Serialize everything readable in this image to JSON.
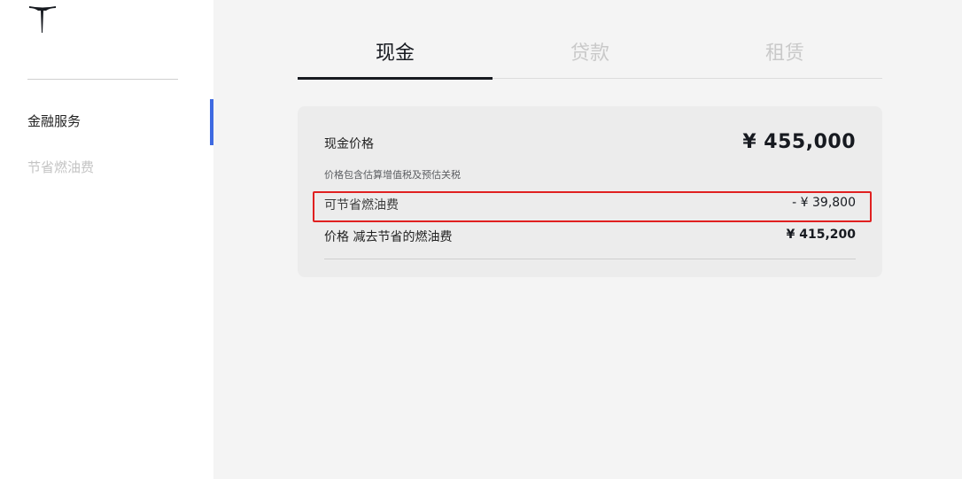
{
  "sidebar": {
    "items": [
      {
        "label": "金融服务",
        "active": true
      },
      {
        "label": "节省燃油费",
        "active": false
      }
    ]
  },
  "tabs": [
    {
      "label": "现金",
      "active": true
    },
    {
      "label": "贷款",
      "active": false
    },
    {
      "label": "租赁",
      "active": false
    }
  ],
  "summary": {
    "cash_price_label": "现金价格",
    "cash_price_value": "¥ 455,000",
    "price_note": "价格包含估算增值税及预估关税",
    "fuel_savings_label": "可节省燃油费",
    "fuel_savings_value": "- ¥ 39,800",
    "net_price_label": "价格 减去节省的燃油费",
    "net_price_value": "¥ 415,200"
  },
  "colors": {
    "accent": "#3e6ae1",
    "highlight": "#e02020",
    "text_primary": "#171a20",
    "text_muted": "#c4c4c4"
  },
  "icons": {
    "logo": "tesla-logo-icon"
  }
}
